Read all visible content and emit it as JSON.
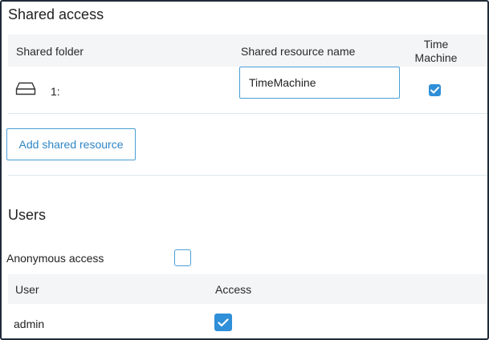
{
  "shared_access": {
    "title": "Shared access",
    "columns": {
      "folder": "Shared folder",
      "resource_name": "Shared resource name",
      "time_machine_line1": "Time",
      "time_machine_line2": "Machine"
    },
    "rows": [
      {
        "folder": "1:",
        "resource_name": "TimeMachine",
        "time_machine": true
      }
    ],
    "add_button": "Add shared resource"
  },
  "users": {
    "title": "Users",
    "anonymous_label": "Anonymous access",
    "anonymous_checked": false,
    "columns": {
      "user": "User",
      "access": "Access"
    },
    "rows": [
      {
        "user": "admin",
        "access": true
      }
    ]
  },
  "colors": {
    "accent": "#2f8fd8",
    "header_bg": "#f4f5f6",
    "frame": "#1e2a36"
  },
  "icons": {
    "drive": "drive-icon",
    "check": "check-icon"
  }
}
